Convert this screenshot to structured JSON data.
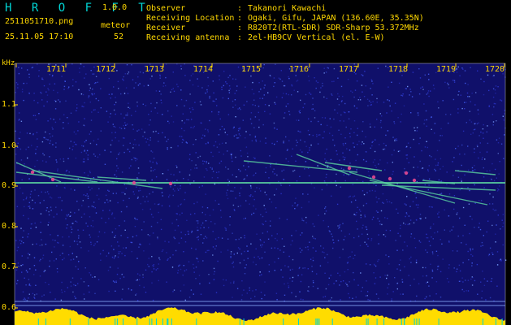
{
  "app": {
    "title": "H R O F F T",
    "version": "1.0.0"
  },
  "file": {
    "name": "2511051710.png",
    "timestamp": "25.11.05 17:10"
  },
  "detection": {
    "label": "meteor",
    "count": "52"
  },
  "station_info": [
    {
      "key": "Observer",
      "value": "Takanori Kawachi"
    },
    {
      "key": "Receiving Location",
      "value": "Ogaki, Gifu, JAPAN (136.60E, 35.35N)"
    },
    {
      "key": "Receiver",
      "value": "R820T2(RTL-SDR) SDR-Sharp 53.372MHz"
    },
    {
      "key": "Receiving antenna",
      "value": "2el-HB9CV Vertical (el. E-W)"
    }
  ],
  "separator": ":",
  "axis": {
    "y_unit": "kHz",
    "x_ticks": [
      "1711",
      "1712",
      "1713",
      "1714",
      "1715",
      "1716",
      "1717",
      "1718",
      "1719",
      "1720"
    ],
    "y_ticks": [
      "1.1",
      "1.0",
      "0.9",
      "0.8",
      "0.7",
      "0.6"
    ]
  },
  "colors": {
    "text": "#ffd800",
    "title": "#00d5d5",
    "background": "#000000",
    "noise_base": "#10106a",
    "carrier": "#5ad2a0",
    "hotspot": "#e64890",
    "activity": "#ffdc00"
  }
}
